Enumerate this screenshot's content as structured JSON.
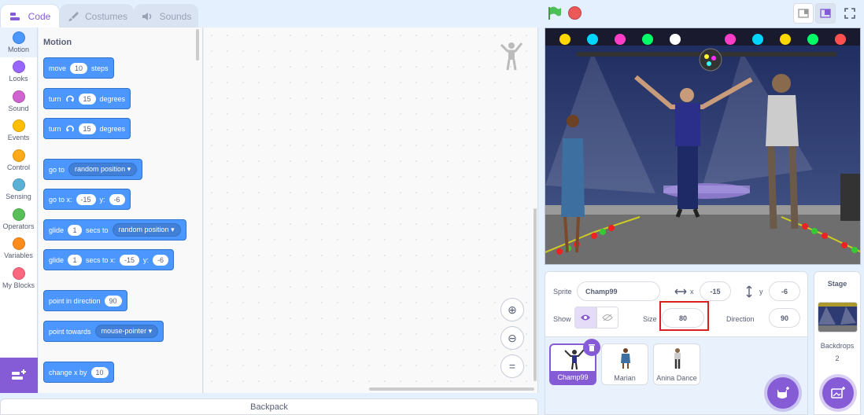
{
  "tabs": [
    {
      "label": "Code"
    },
    {
      "label": "Costumes"
    },
    {
      "label": "Sounds"
    }
  ],
  "categories": [
    {
      "label": "Motion",
      "color": "#4c97ff"
    },
    {
      "label": "Looks",
      "color": "#9966ff"
    },
    {
      "label": "Sound",
      "color": "#cf63cf"
    },
    {
      "label": "Events",
      "color": "#ffbf00"
    },
    {
      "label": "Control",
      "color": "#ffab19"
    },
    {
      "label": "Sensing",
      "color": "#5cb1d6"
    },
    {
      "label": "Operators",
      "color": "#59c059"
    },
    {
      "label": "Variables",
      "color": "#ff8c1a"
    },
    {
      "label": "My Blocks",
      "color": "#ff6680"
    }
  ],
  "palette": {
    "title": "Motion",
    "move": {
      "pre": "move",
      "value": "10",
      "post": "steps"
    },
    "turn_cw": {
      "pre": "turn",
      "value": "15",
      "post": "degrees"
    },
    "turn_ccw": {
      "pre": "turn",
      "value": "15",
      "post": "degrees"
    },
    "goto": {
      "pre": "go to",
      "option": "random position"
    },
    "gotoxy": {
      "pre": "go to x:",
      "x": "-15",
      "ylbl": "y:",
      "y": "-6"
    },
    "glide": {
      "pre": "glide",
      "value": "1",
      "mid": "secs to",
      "option": "random position"
    },
    "glidexy": {
      "pre": "glide",
      "value": "1",
      "mid": "secs to x:",
      "x": "-15",
      "ylbl": "y:",
      "y": "-6"
    },
    "point_dir": {
      "pre": "point in direction",
      "value": "90"
    },
    "point_towards": {
      "pre": "point towards",
      "option": "mouse-pointer"
    },
    "change_x": {
      "pre": "change x by",
      "value": "10"
    }
  },
  "backpack": "Backpack",
  "sprite_info": {
    "sprite_label": "Sprite",
    "sprite_name": "Champ99",
    "x_label": "x",
    "x_value": "-15",
    "y_label": "y",
    "y_value": "-6",
    "show_label": "Show",
    "size_label": "Size",
    "size_value": "80",
    "direction_label": "Direction",
    "direction_value": "90"
  },
  "sprites": [
    {
      "name": "Champ99"
    },
    {
      "name": "Marian"
    },
    {
      "name": "Anina Dance"
    }
  ],
  "stage_pane": {
    "title": "Stage",
    "backdrops_label": "Backdrops",
    "backdrops_count": "2"
  },
  "colors": {
    "accent": "#855cd6",
    "motion": "#4c97ff",
    "highlight": "#d92020"
  }
}
